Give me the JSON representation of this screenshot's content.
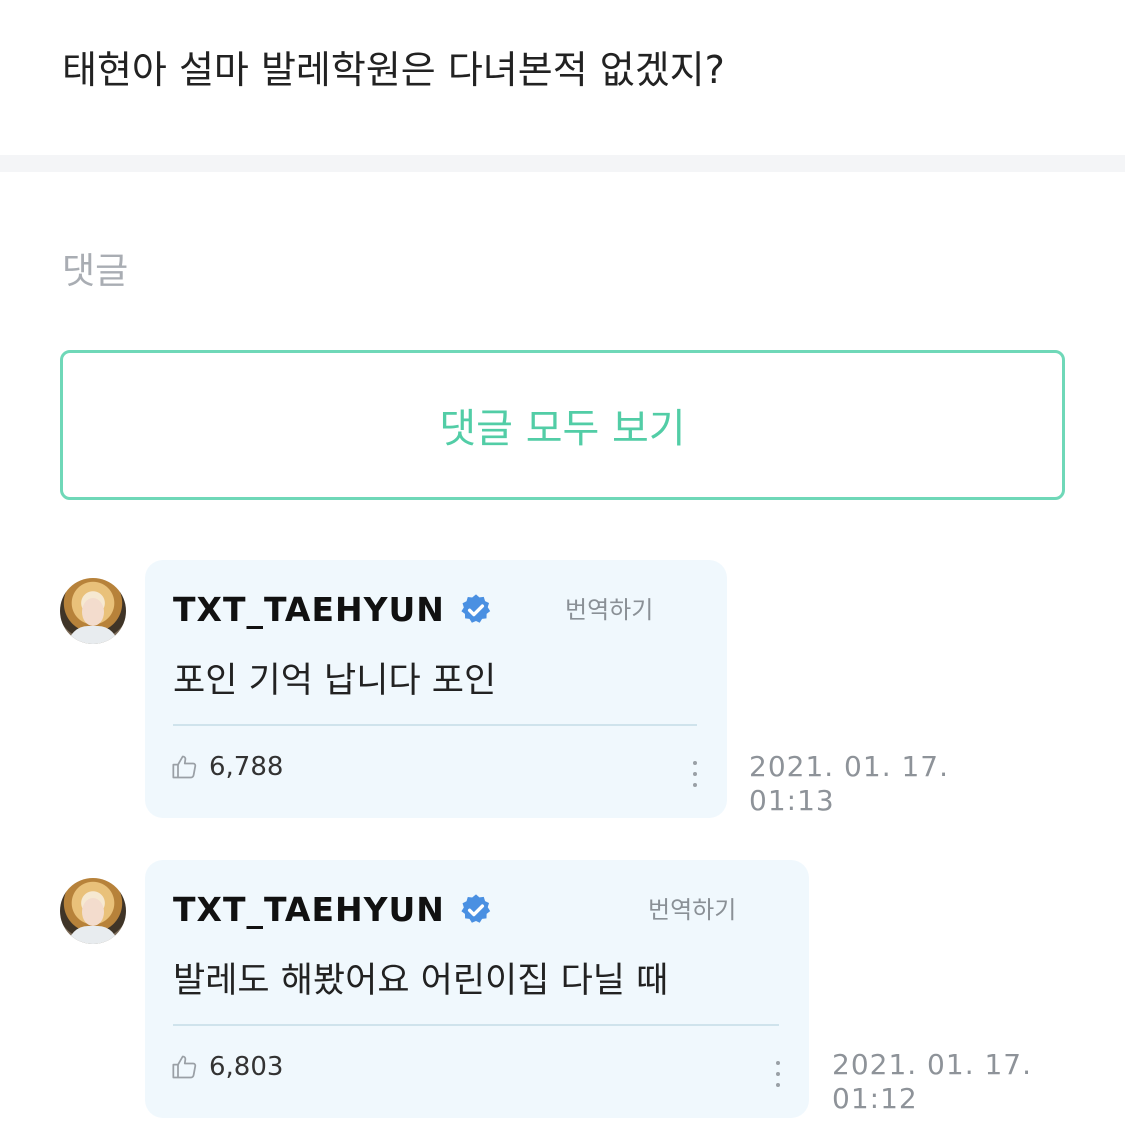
{
  "question": "태현아 설마 발레학원은 다녀본적 없겠지?",
  "comments_section": {
    "label": "댓글",
    "view_all_label": "댓글 모두 보기"
  },
  "comments": [
    {
      "author": "TXT_TAEHYUN",
      "translate_label": "번역하기",
      "text": "포인 기억 납니다 포인",
      "likes": "6,788",
      "date": "2021. 01. 17.",
      "time": "01:13"
    },
    {
      "author": "TXT_TAEHYUN",
      "translate_label": "번역하기",
      "text": "발레도 해봤어요 어린이집 다닐 때",
      "likes": "6,803",
      "date": "2021. 01. 17.",
      "time": "01:12"
    }
  ],
  "colors": {
    "accent": "#52cda6",
    "bubble_bg": "#f0f8fd",
    "verified": "#4a90e2"
  },
  "icons": {
    "verified": "verified-badge-icon",
    "like": "thumbs-up-icon",
    "more": "more-vertical-icon"
  }
}
